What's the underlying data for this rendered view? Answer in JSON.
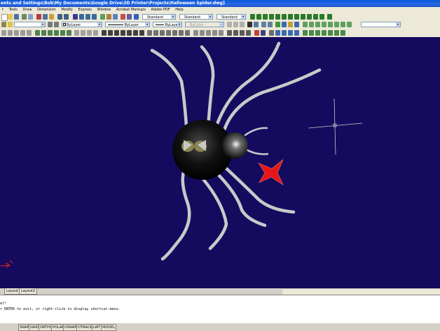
{
  "window": {
    "title": "ents and Settings\\Bob\\My Documents\\Google Drive\\3D Printer\\Projects\\Halloween Spider.dwg]"
  },
  "menu": [
    "t",
    "Tools",
    "Draw",
    "Dimension",
    "Modify",
    "Express",
    "Window",
    "Acrobat Markups",
    "Adobe PDF",
    "Help"
  ],
  "styles_toolbar": {
    "text_style": "Standard",
    "dim_style": "Standard",
    "table_style": "Standard"
  },
  "properties_toolbar": {
    "layer": "ByLayer",
    "linetype": "ByLayer",
    "lineweight": "ByLayer",
    "plot_style": "ByColor"
  },
  "layout_tabs": [
    "Layout1",
    "Layout2"
  ],
  "command_line": {
    "line1": "el*",
    "line2": "r ENTER to exit, or right-click to display shortcut-menu."
  },
  "status_bar": [
    "SNAP",
    "GRID",
    "ORTHO",
    "POLAR",
    "OSNAP",
    "OTRACK",
    "LWT",
    "MODEL"
  ],
  "colors": {
    "canvas_bg": "#150b5e",
    "leg_color": "#c9c9c9",
    "bow_color": "#e41616",
    "crosshair": "#c8c8c8",
    "titlebar": "#0a58d8"
  },
  "icons": [
    "ucs-icon",
    "crosshair-cursor",
    "spider-model"
  ]
}
